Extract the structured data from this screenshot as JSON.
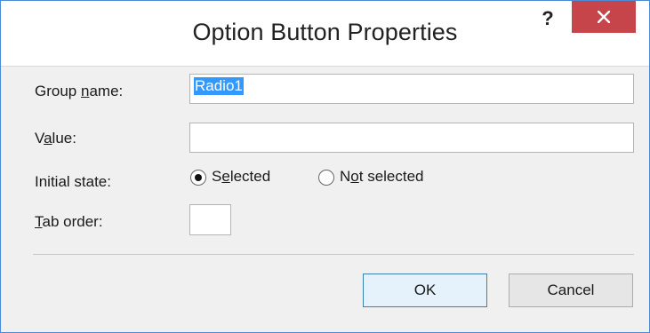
{
  "window": {
    "title": "Option Button Properties",
    "help_label": "?",
    "close_icon": "close-icon"
  },
  "fields": {
    "group_name": {
      "label": "Group name:",
      "value": "Radio1"
    },
    "value": {
      "label": "Value:",
      "value": ""
    },
    "initial_state": {
      "label": "Initial state:",
      "options": [
        "Selected",
        "Not selected"
      ],
      "selected": "Selected"
    },
    "tab_order": {
      "label": "Tab order:",
      "value": ""
    }
  },
  "buttons": {
    "ok": "OK",
    "cancel": "Cancel"
  },
  "colors": {
    "close_bg": "#c6454a",
    "selection_bg": "#3399ff",
    "window_border": "#4a8bd4"
  }
}
